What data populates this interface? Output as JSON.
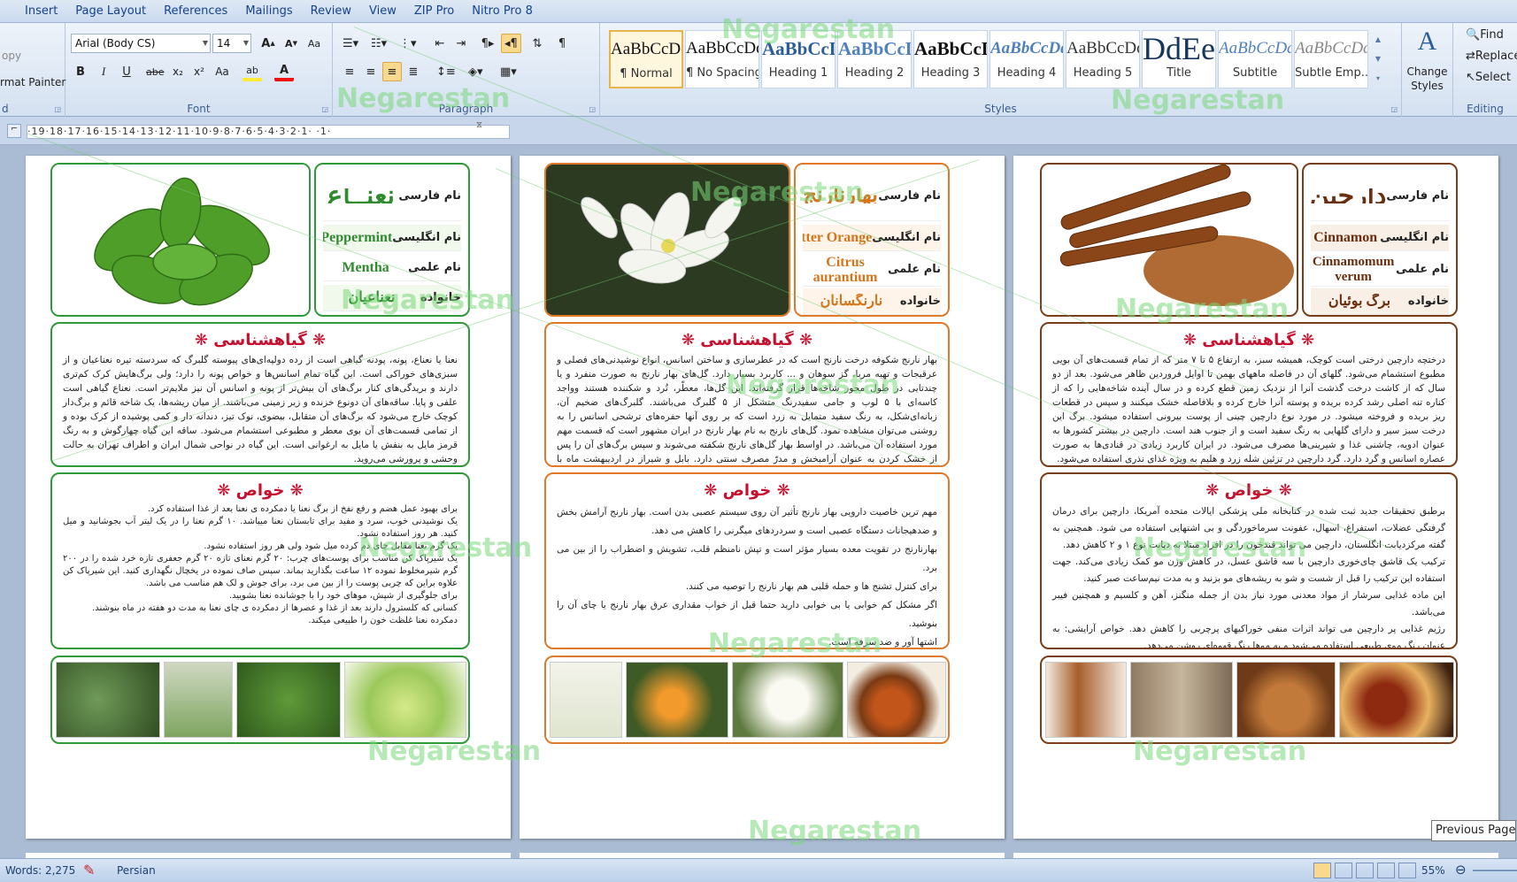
{
  "menu": {
    "tabs": [
      "Insert",
      "Page Layout",
      "References",
      "Mailings",
      "Review",
      "View",
      "ZIP Pro",
      "Nitro Pro 8"
    ]
  },
  "ribbon": {
    "clipboard": {
      "copy_label": "opy",
      "format_painter_label": "rmat Painter",
      "group_label": "d"
    },
    "font": {
      "font_name": "Arial (Body CS)",
      "font_size": "14",
      "group_label": "Font",
      "grow_label": "A",
      "shrink_label": "A",
      "clear_label": "Aa",
      "bold_label": "B",
      "italic_label": "I",
      "underline_label": "U",
      "strike_label": "abe",
      "subscript_label": "x₂",
      "superscript_label": "x²",
      "case_label": "Aa",
      "highlight_label": "ab",
      "color_label": "A"
    },
    "paragraph": {
      "group_label": "Paragraph"
    },
    "styles": {
      "group_label": "Styles",
      "items": [
        {
          "preview": "AaBbCcDdEe",
          "name": "¶ Normal"
        },
        {
          "preview": "AaBbCcDdEe",
          "name": "¶ No Spacing"
        },
        {
          "preview": "AaBbCcDdEe",
          "name": "Heading 1"
        },
        {
          "preview": "AaBbCcDdEe",
          "name": "Heading 2"
        },
        {
          "preview": "AaBbCcDdEe",
          "name": "Heading 3"
        },
        {
          "preview": "AaBbCcDdEe",
          "name": "Heading 4"
        },
        {
          "preview": "AaBbCcDdEe",
          "name": "Heading 5"
        },
        {
          "preview": "AaBbCcDdEe",
          "name": "Title"
        },
        {
          "preview": "AaBbCcDdEe",
          "name": "Subtitle"
        },
        {
          "preview": "AaBbCcDdEe",
          "name": "Subtle Emp..."
        }
      ],
      "change_styles_line1": "Change",
      "change_styles_line2": "Styles"
    },
    "editing": {
      "find": "Find",
      "replace": "Replace",
      "select": "Select",
      "group_label": "Editing"
    }
  },
  "ruler": {
    "numbers": "·19·18·17·16·15·14·13·12·11·10·9·8·7·6·5·4·3·2·1· ·1·"
  },
  "watermark": "Negarestan",
  "labels": {
    "persian_name": "نام فارسی",
    "english_name": "نام انگلیسی",
    "scientific_name": "نام علمی",
    "family": "خانواده",
    "botany": "گیاهشناسی",
    "properties": "خواص",
    "star": "❋"
  },
  "pages": {
    "mint": {
      "persian_name": "نعنــاع",
      "english_name": "Peppermint",
      "scientific_name": "Mentha",
      "family": "نعناعیان",
      "botany": "نعنا یا نعناع، پونه، پودنه گیاهی است از رده دولپه‌ای‌های پیوسته گلبرگ که سردسته تیره نعناعیان و از سبزی‌های خوراکی است. این گیاه تمام اسانس‌ها و خواص پونه را دارد؛ ولی برگ‌هایش کرک کم‌تری دارند و بریدگی‌های کنار برگ‌های آن بیش‌تر از پونه و اسانس آن نیز ملایم‌تر است. نعناع گیاهی است علفی و پایا. ساقه‌های آن دونوع خزنده و زیر زمینی می‌باشند. از میان ریشه‌ها، یک شاخه قائم و برگ‌دار کوچک خارج می‌شود که برگ‌های آن متقابل، بیضوی، نوک تیز، دندانه دار و کمی پوشیده از کرک بوده و از تمامی قسمت‌های آن بوی معطر و مطبوعی استشمام می‌شود. ساقه این گیاه چهارگوش و به رنگ قرمز مایل به بنفش یا مایل به ارغوانی است. این گیاه در نواحی شمال ایران و اطراف تهران به حالت وحشی و پرورشی می‌روید.",
      "properties": [
        "برای بهبود عمل هضم و رفع نفخ از برگ نعنا یا دمکرده ی نعنا بعد از غذا استفاده کرد.",
        "یک نوشیدنی خوب، سرد و مفید برای تابستان نعنا میباشد. ۱۰ گرم نعنا را در یک لیتر آب بجوشانید و میل کنید. هر روز استفاده نشود.",
        "یک گرم نعنا مقابل چای دم کرده میل شود ولی هر روز استفاده نشود.",
        "یک شیرپاک کن مناسب برای پوست‌های چرب: ۲۰ گرم نعنای تازه ۲۰ گرم جعفری تازه خرد شده را در ۲۰۰ گرم شیرمخلوط نموده ۱۲ ساعت بگذارید بماند. سپس صاف نموده در یخچال نگهداری کنید. این شیرپاک کن علاوه براین که چربی پوست را از بین می برد، برای جوش و لک هم مناسب می باشد.",
        "برای جلوگیری از شپش، موهای خود را با جوشانده نعنا بشویید.",
        "کسانی که کلسترول دارند بعد از غذا و عصرها از دمکرده ی چای نعنا به مدت دو هفته در ماه بنوشند.",
        "دمکرده نعنا غلظت خون را طبیعی میکند."
      ]
    },
    "orange": {
      "persian_name": "بهارنارنج",
      "english_name": "Bitter Orange",
      "scientific_name_1": "Citrus",
      "scientific_name_2": "aurantium",
      "family": "نارنگسانان",
      "botany": "بهار نارنج شکوفه درخت نارنج است که در عطرسازی و ساختن اسانس، انواع نوشیدنی‌های فصلی و عرقیجات و تهیه مربا، گز سوهان و ... کاربرد بسیار دارد. گل‌های بهار نارنج به صورت منفرد و یا چندتایی در طول محور شاخه‌ها قرار گرفته‌اند. این گل‌ها، معطّر، تُرد و شکننده هستند وواجد کاسه‌ای با ۵ لوب و جامی سفیدرنگ متشکل از ۵ گلبرگ می‌باشند. گلبرگ‌های ضخیم آن، زبانه‌ای‌شکل، به رنگ سفید متمایل به زرد است که بر روی آنها حفره‌های ترشحی اسانس را به روشنی می‌توان مشاهده نمود. گل‌های نارنج به نام بهار نارنج در ایران مشهور است که قسمت مهم مورد استفاده آن می‌باشد. در اواسط بهار گل‌های نارنج شکفته می‌شوند و سپس برگ‌های آن را پس از خشک کردن به عنوان آرامبخش و مدرّ مصرف سنتی دارد. بابل و شیراز در اردیبهشت ماه با رایحه ی سحرانگیز بهار نارنج، هر رهگذری را سرمست میکند.",
      "properties": [
        "مهم ترین خاصیت دارویی بهار نارنج تأثیر آن روی سیستم عصبی بدن است. بهار نارنج آرامش بخش و ضدهیجانات دستگاه عصبی است و سردردهای میگرنی را کاهش می دهد.",
        "بهارنارنج در تقویت معده بسیار مؤثر است و تپش نامنظم قلب، تشویش و اضطراب را از بین می برد.",
        "برای کنترل تشنج ها و حمله قلبی هم بهار نارنج را توصیه می کنند.",
        "اگر مشکل کم خوابی یا بی خوابی دارید حتما قبل از خواب مقداری عرق بهار نارنج یا چای آن را بنوشید.",
        "اشتها آور و ضد سرفه است."
      ]
    },
    "cinnamon": {
      "persian_name": "دارچین",
      "english_name": "Cinnamon",
      "scientific_name_1": "Cinnamomum",
      "scientific_name_2": "verum",
      "family": "برگ بوئیان",
      "botany": "درختچه دارچین درختی است کوچک، همیشه سبز، به ارتفاع ۵ تا ۷ متر که از تمام قسمت‌های آن بویی مطبوع استشمام می‌شود. گلهای آن در فاصله ماههای بهمن تا اوایل فروردین ظاهر می‌شود. بعد از دو سال که از کاشت درخت گذشت آنرا از نزدیک زمین قطع کرده و در سال آینده شاخه‌هایی را که از کناره تنه اصلی رشد کرده بریده و پوسته آنرا خارج کرده و بلافاصله خشک میکنند و سپس در قطعات ریز بریده و فروخته میشود. در مورد نوع دارچین چینی از پوست بیرونی استفاده میشود. برگ این درخت سبز سیر و دارای گلهایی به رنگ سفید است و از جنوب هند است. دارچین در بیشتر کشورها به عنوان ادویه، چاشنی غذا و شیرینی‌ها مصرف می‌شود. در ایران کاربرد زیادی در قنادی‌ها به صورت عصاره اسانس و گرد دارد. گرد دارچین در تزئین شله زرد و هلیم به ویژه غذای نذری استفاده می‌شود.",
      "properties": [
        "برطبق تحقیقات جدید ثبت شده در کتابخانه ملی پزشکی ایالات متحده آمریکا، دارچین برای درمان گرفتگی عضلات، استفراغ، اسهال، عفونت سرماخوردگی و بی اشتهایی استفاده می شود. همچنین به گفته مرکزدیابت انگلستان، دارچین می تواند قندخون را در افراد مبتلا به دیابت نوع ۱ و ۲ کاهش دهد.",
        "ترکیب یک قاشق چای‌خوری دارچین با سه قاشق عسل، در کاهش وزن مو کمک زیادی می‌کند. جهت استفاده این ترکیب را قبل از شست و شو به ریشه‌های مو بزنید و به مدت نیم‌ساعت صبر کنید.",
        "این ماده غذایی سرشار از مواد معدنی مورد نیاز بدن از جمله منگنز، آهن و کلسیم و همچنین فیبر می‌باشد.",
        "رژیم غذایی پر دارچین می تواند اثرات منفی خوراکیهای پرچربی را کاهش دهد. خواص آرایشی: به عنوان رنگ موی طبیعی استفاده می‌شود و به موها رنگ قهوه‌ای روشن می‌دهد."
      ]
    }
  },
  "tooltip": "Previous Page",
  "status": {
    "words": "Words: 2,275",
    "language": "Persian",
    "zoom": "55%"
  },
  "colors": {
    "mint_border": "#2e9a3a",
    "orange_border": "#e07a2a",
    "cinnamon_border": "#7a3e18",
    "title_red": "#c8102e",
    "mint_text": "#2e8b2e",
    "orange_text": "#d4751a",
    "cinnamon_text": "#6b2e0e"
  }
}
